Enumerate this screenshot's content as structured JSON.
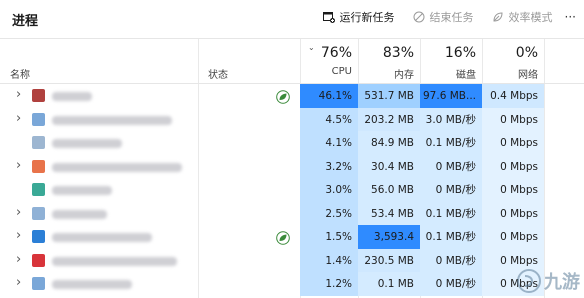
{
  "header": {
    "title": "进程",
    "actions": {
      "run_new_task": "运行新任务",
      "end_task": "结束任务",
      "efficiency_mode": "效率模式",
      "more": "···"
    }
  },
  "columns": {
    "name": "名称",
    "status": "状态",
    "cpu": {
      "pct": "76%",
      "label": "CPU"
    },
    "memory": {
      "pct": "83%",
      "label": "内存"
    },
    "disk": {
      "pct": "16%",
      "label": "磁盘"
    },
    "network": {
      "pct": "0%",
      "label": "网络"
    }
  },
  "rows": [
    {
      "cpu": "46.1%",
      "mem": "531.7 MB",
      "disk": "97.6 MB...",
      "net": "0.4 Mbps",
      "icon_color": "#b0413e",
      "leaf": true,
      "chevron": true,
      "cpu_bg": "#2f8bff",
      "mem_bg": "#9fd0ff",
      "disk_bg": "#2f8bff",
      "net_bg": "#cfe8ff"
    },
    {
      "cpu": "4.5%",
      "mem": "203.2 MB",
      "disk": "3.0 MB/秒",
      "net": "0 Mbps",
      "icon_color": "#7aa7d8",
      "leaf": false,
      "chevron": true,
      "cpu_bg": "#bfe0ff",
      "mem_bg": "#cfe8ff",
      "disk_bg": "#d4ebff",
      "net_bg": "#e3f2ff"
    },
    {
      "cpu": "4.1%",
      "mem": "84.9 MB",
      "disk": "0.1 MB/秒",
      "net": "0 Mbps",
      "icon_color": "#9db6d1",
      "leaf": false,
      "chevron": false,
      "cpu_bg": "#bfe0ff",
      "mem_bg": "#d4ebff",
      "disk_bg": "#d4ebff",
      "net_bg": "#e3f2ff"
    },
    {
      "cpu": "3.2%",
      "mem": "30.4 MB",
      "disk": "0 MB/秒",
      "net": "0 Mbps",
      "icon_color": "#e8734a",
      "leaf": false,
      "chevron": true,
      "cpu_bg": "#bfe0ff",
      "mem_bg": "#d4ebff",
      "disk_bg": "#d4ebff",
      "net_bg": "#e3f2ff"
    },
    {
      "cpu": "3.0%",
      "mem": "56.0 MB",
      "disk": "0 MB/秒",
      "net": "0 Mbps",
      "icon_color": "#3aa996",
      "leaf": false,
      "chevron": false,
      "cpu_bg": "#bfe0ff",
      "mem_bg": "#d4ebff",
      "disk_bg": "#d4ebff",
      "net_bg": "#e3f2ff"
    },
    {
      "cpu": "2.5%",
      "mem": "53.4 MB",
      "disk": "0.1 MB/秒",
      "net": "0 Mbps",
      "icon_color": "#8fb1d6",
      "leaf": false,
      "chevron": true,
      "cpu_bg": "#bfe0ff",
      "mem_bg": "#d4ebff",
      "disk_bg": "#d4ebff",
      "net_bg": "#e3f2ff"
    },
    {
      "cpu": "1.5%",
      "mem": "3,593.4",
      "disk": "0.1 MB/秒",
      "net": "0 Mbps",
      "icon_color": "#2b7fd6",
      "leaf": true,
      "chevron": true,
      "cpu_bg": "#bfe0ff",
      "mem_bg": "#2f8bff",
      "disk_bg": "#d4ebff",
      "net_bg": "#e3f2ff"
    },
    {
      "cpu": "1.4%",
      "mem": "230.5 MB",
      "disk": "0 MB/秒",
      "net": "0 Mbps",
      "icon_color": "#d8343a",
      "leaf": false,
      "chevron": true,
      "cpu_bg": "#bfe0ff",
      "mem_bg": "#cfe8ff",
      "disk_bg": "#d4ebff",
      "net_bg": "#e3f2ff"
    },
    {
      "cpu": "1.2%",
      "mem": "0.1 MB",
      "disk": "0 MB/秒",
      "net": "0 Mbps",
      "icon_color": "#7aa7d8",
      "leaf": false,
      "chevron": true,
      "cpu_bg": "#bfe0ff",
      "mem_bg": "#d4ebff",
      "disk_bg": "#d4ebff",
      "net_bg": "#e3f2ff"
    }
  ],
  "watermark": {
    "text": "九游"
  }
}
